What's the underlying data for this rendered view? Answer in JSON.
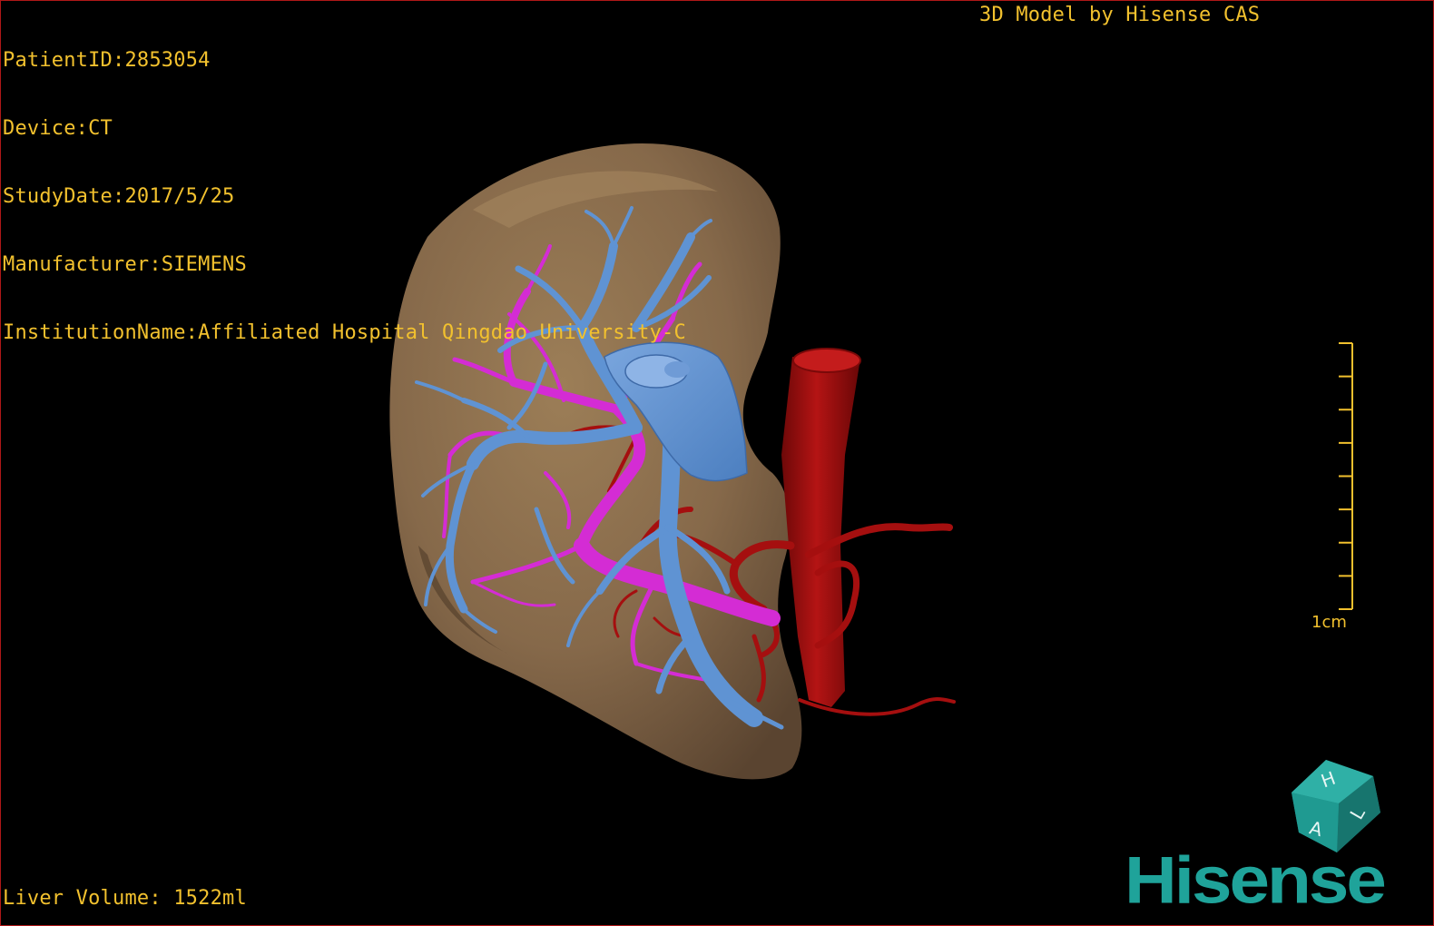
{
  "patient_info": {
    "patient_id": "PatientID:2853054",
    "device": "Device:CT",
    "study_date": "StudyDate:2017/5/25",
    "manufacturer": "Manufacturer:SIEMENS",
    "institution": "InstitutionName:Affiliated Hospital Qingdao University-C"
  },
  "credit": "3D Model by Hisense CAS",
  "liver_volume": "Liver Volume: 1522ml",
  "scale_bar": {
    "label": "1cm",
    "tick_count": 9
  },
  "brand": {
    "name": "Hisense",
    "color": "#1fa39a"
  },
  "orientation_cube": {
    "faces": [
      "H",
      "L",
      "A"
    ]
  },
  "colors": {
    "text": "#f2c12e",
    "liver": "#8a6e4b",
    "portal_vein": "#d42cd4",
    "hepatic_vein": "#5f93d3",
    "artery": "#a50f0f",
    "border": "#b01818"
  },
  "model_structures": [
    "liver",
    "hepatic-vein",
    "portal-vein",
    "artery",
    "aorta"
  ]
}
